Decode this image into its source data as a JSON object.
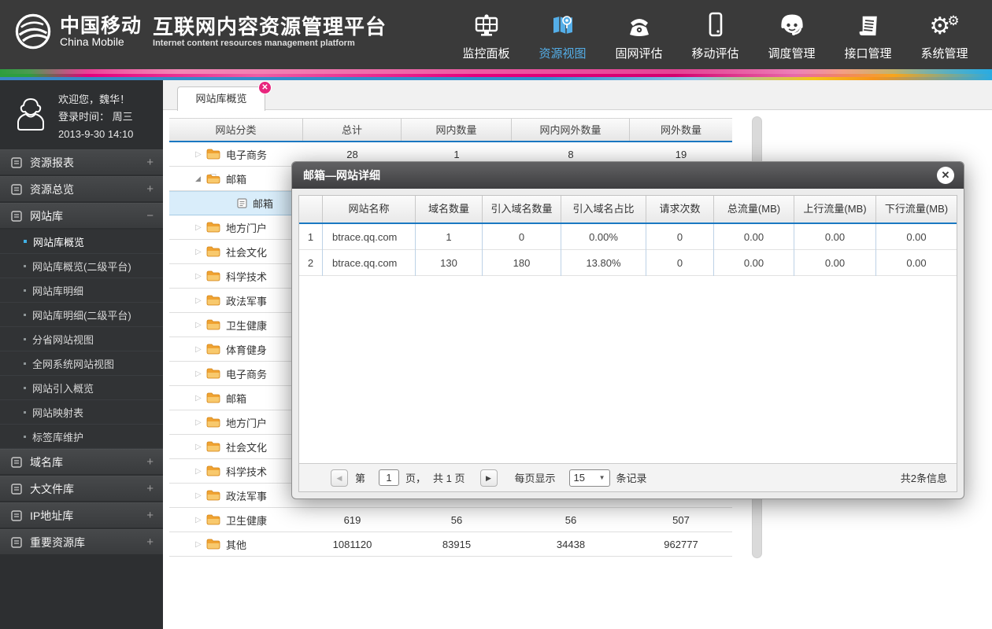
{
  "header": {
    "brand": {
      "cn": "中国移动",
      "en": "China Mobile",
      "title": "互联网内容资源管理平台",
      "subtitle": "Internet content resources management platform"
    },
    "accent_color": "#54aee8",
    "nav": [
      {
        "label": "监控面板",
        "icon": "dashboard-icon",
        "active": false
      },
      {
        "label": "资源视图",
        "icon": "map-icon",
        "active": true
      },
      {
        "label": "固网评估",
        "icon": "phone-icon",
        "active": false
      },
      {
        "label": "移动评估",
        "icon": "mobile-icon",
        "active": false
      },
      {
        "label": "调度管理",
        "icon": "headset-icon",
        "active": false
      },
      {
        "label": "接口管理",
        "icon": "document-icon",
        "active": false
      },
      {
        "label": "系统管理",
        "icon": "gears-icon",
        "active": false
      }
    ]
  },
  "sidebar": {
    "user": {
      "welcome": "欢迎您，魏华！",
      "login_label": "登录时间：  周三",
      "login_time": "2013-9-30   14:10"
    },
    "sections": [
      {
        "label": "资源报表",
        "toggle": "+"
      },
      {
        "label": "资源总览",
        "toggle": "+"
      },
      {
        "label": "网站库",
        "toggle": "−"
      },
      {
        "label": "域名库",
        "toggle": "+"
      },
      {
        "label": "大文件库",
        "toggle": "+"
      },
      {
        "label": "IP地址库",
        "toggle": "+"
      },
      {
        "label": "重要资源库",
        "toggle": "+"
      }
    ],
    "website_submenu": [
      {
        "label": "网站库概览",
        "active": true
      },
      {
        "label": "网站库概览(二级平台)",
        "active": false
      },
      {
        "label": "网站库明细",
        "active": false
      },
      {
        "label": "网站库明细(二级平台)",
        "active": false
      },
      {
        "label": "分省网站视图",
        "active": false
      },
      {
        "label": "全网系统网站视图",
        "active": false
      },
      {
        "label": "网站引入概览",
        "active": false
      },
      {
        "label": "网站映射表",
        "active": false
      },
      {
        "label": "标签库维护",
        "active": false
      }
    ]
  },
  "tab": {
    "label": "网站库概览",
    "close": "✕"
  },
  "main_table": {
    "headers": [
      "网站分类",
      "总计",
      "网内数量",
      "网内网外数量",
      "网外数量"
    ],
    "rows": [
      {
        "icon": "folder-icon",
        "state": "collapsed",
        "label": "电子商务",
        "values": [
          "28",
          "1",
          "8",
          "19"
        ]
      },
      {
        "icon": "folder-open-icon",
        "state": "expanded",
        "label": "邮箱",
        "values": [
          "",
          "",
          "",
          ""
        ]
      },
      {
        "icon": "document-icon",
        "state": "leaf",
        "label": "邮箱",
        "selected": true,
        "values": [
          "",
          "",
          "",
          ""
        ]
      },
      {
        "icon": "folder-icon",
        "state": "collapsed",
        "label": "地方门户",
        "values": [
          "",
          "",
          "",
          ""
        ]
      },
      {
        "icon": "folder-icon",
        "state": "collapsed",
        "label": "社会文化",
        "values": [
          "",
          "",
          "",
          ""
        ]
      },
      {
        "icon": "folder-icon",
        "state": "collapsed",
        "label": "科学技术",
        "values": [
          "",
          "",
          "",
          ""
        ]
      },
      {
        "icon": "folder-icon",
        "state": "collapsed",
        "label": "政法军事",
        "values": [
          "",
          "",
          "",
          ""
        ]
      },
      {
        "icon": "folder-icon",
        "state": "collapsed",
        "label": "卫生健康",
        "values": [
          "",
          "",
          "",
          ""
        ]
      },
      {
        "icon": "folder-icon",
        "state": "collapsed",
        "label": "体育健身",
        "values": [
          "",
          "",
          "",
          ""
        ]
      },
      {
        "icon": "folder-icon",
        "state": "collapsed",
        "label": "电子商务",
        "values": [
          "",
          "",
          "",
          ""
        ]
      },
      {
        "icon": "folder-icon",
        "state": "collapsed",
        "label": "邮箱",
        "values": [
          "",
          "",
          "",
          ""
        ]
      },
      {
        "icon": "folder-icon",
        "state": "collapsed",
        "label": "地方门户",
        "values": [
          "",
          "",
          "",
          ""
        ]
      },
      {
        "icon": "folder-icon",
        "state": "collapsed",
        "label": "社会文化",
        "values": [
          "",
          "",
          "",
          ""
        ]
      },
      {
        "icon": "folder-icon",
        "state": "collapsed",
        "label": "科学技术",
        "values": [
          "",
          "",
          "",
          ""
        ]
      },
      {
        "icon": "folder-icon",
        "state": "collapsed",
        "label": "政法军事",
        "values": [
          "",
          "",
          "",
          ""
        ]
      },
      {
        "icon": "folder-icon",
        "state": "collapsed",
        "label": "卫生健康",
        "values": [
          "619",
          "56",
          "56",
          "507"
        ]
      },
      {
        "icon": "folder-icon",
        "state": "collapsed",
        "label": "其他",
        "values": [
          "1081120",
          "83915",
          "34438",
          "962777"
        ]
      }
    ]
  },
  "modal": {
    "title": "邮箱—网站详细",
    "close": "✕",
    "table": {
      "headers": [
        "",
        "网站名称",
        "域名数量",
        "引入域名数量",
        "引入域名占比",
        "请求次数",
        "总流量(MB)",
        "上行流量(MB)",
        "下行流量(MB)"
      ],
      "rows": [
        [
          "1",
          "btrace.qq.com",
          "1",
          "0",
          "0.00%",
          "0",
          "0.00",
          "0.00",
          "0.00"
        ],
        [
          "2",
          "btrace.qq.com",
          "130",
          "180",
          "13.80%",
          "0",
          "0.00",
          "0.00",
          "0.00"
        ]
      ]
    },
    "pagination": {
      "page_prefix": "第",
      "page_value": "1",
      "page_suffix": "页，",
      "total_pages": "共 1 页",
      "per_page_label": "每页显示",
      "per_page_value": "15",
      "per_page_suffix": "条记录",
      "total_info": "共2条信息"
    }
  }
}
